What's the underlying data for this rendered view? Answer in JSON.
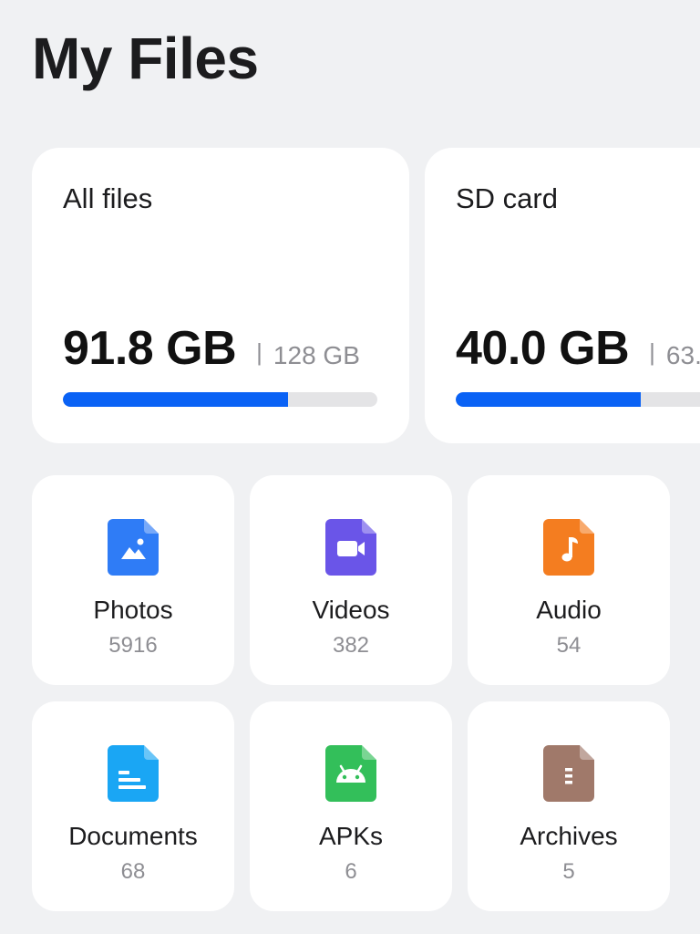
{
  "header": {
    "title": "My Files"
  },
  "storage": [
    {
      "name": "All files",
      "used": "91.8 GB",
      "separator": "|",
      "total": "128 GB",
      "fraction": 0.717,
      "color": "#0a62f5"
    },
    {
      "name": "SD card",
      "used": "40.0 GB",
      "separator": "|",
      "total": "63.",
      "fraction": 0.635,
      "color": "#0a62f5"
    }
  ],
  "categories": [
    {
      "label": "Photos",
      "count": "5916",
      "icon": "photo-icon",
      "color": "#2f7cf6"
    },
    {
      "label": "Videos",
      "count": "382",
      "icon": "video-icon",
      "color": "#6a55e8"
    },
    {
      "label": "Audio",
      "count": "54",
      "icon": "music-note-icon",
      "color": "#f47d20"
    },
    {
      "label": "Documents",
      "count": "68",
      "icon": "document-icon",
      "color": "#1aa6f4"
    },
    {
      "label": "APKs",
      "count": "6",
      "icon": "android-icon",
      "color": "#33bf5a"
    },
    {
      "label": "Archives",
      "count": "5",
      "icon": "archive-icon",
      "color": "#a0796a"
    }
  ]
}
